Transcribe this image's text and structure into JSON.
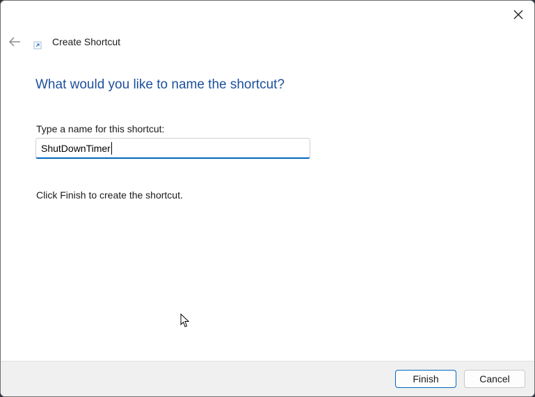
{
  "window": {
    "title": "Create Shortcut",
    "close_icon": "close-icon",
    "back_icon": "back-arrow-icon",
    "app_icon": "shortcut-icon"
  },
  "page": {
    "heading": "What would you like to name the shortcut?",
    "field_label": "Type a name for this shortcut:",
    "name_value": "ShutDownTimer",
    "note": "Click Finish to create the shortcut."
  },
  "footer": {
    "finish_label": "Finish",
    "cancel_label": "Cancel"
  },
  "colors": {
    "heading": "#1c4f9c",
    "accent": "#0067c0",
    "footer_bg": "#f0f0f0"
  }
}
